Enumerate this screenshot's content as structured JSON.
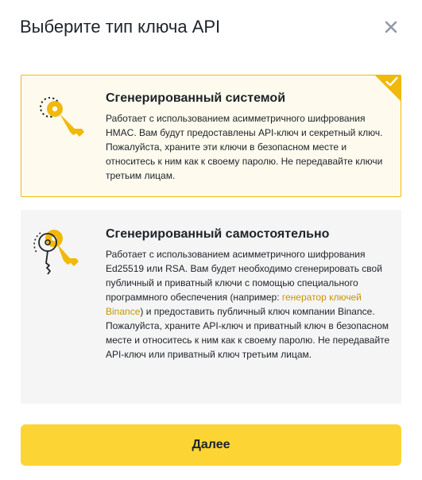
{
  "dialog": {
    "title": "Выберите тип ключа API",
    "close_icon": "close-icon"
  },
  "options": [
    {
      "title": "Сгенерированный системой",
      "description": "Работает с использованием асимметричного шифрования HMAC. Вам будут предоставлены API-ключ и секретный ключ. Пожалуйста, храните эти ключи в безопасном месте и относитесь к ним как к своему паролю. Не передавайте ключи третьим лицам.",
      "icon": "system-key-icon",
      "selected": true
    },
    {
      "title": "Сгенерированный самостоятельно",
      "description_before": "Работает с использованием асимметричного шифрования Ed25519 или RSA. Вам будет необходимо сгенерировать свой публичный и приватный ключи с помощью специального программного обеспечения (например: ",
      "link_text": "генератор ключей Binance",
      "description_after": ") и предоставить публичный ключ компании Binance. Пожалуйста, храните API-ключ и приватный ключ в безопасном месте и относитесь к ним как к своему паролю. Не передавайте API-ключ или приватный ключ третьим лицам.",
      "icon": "self-generated-keys-icon",
      "selected": false
    }
  ],
  "next_button": {
    "label": "Далее"
  },
  "colors": {
    "accent": "#f0b90b",
    "button": "#fcd535",
    "selected_bg": "#fefbee",
    "card_bg": "#f5f5f5",
    "link": "#c99400",
    "text": "#1e2329"
  }
}
